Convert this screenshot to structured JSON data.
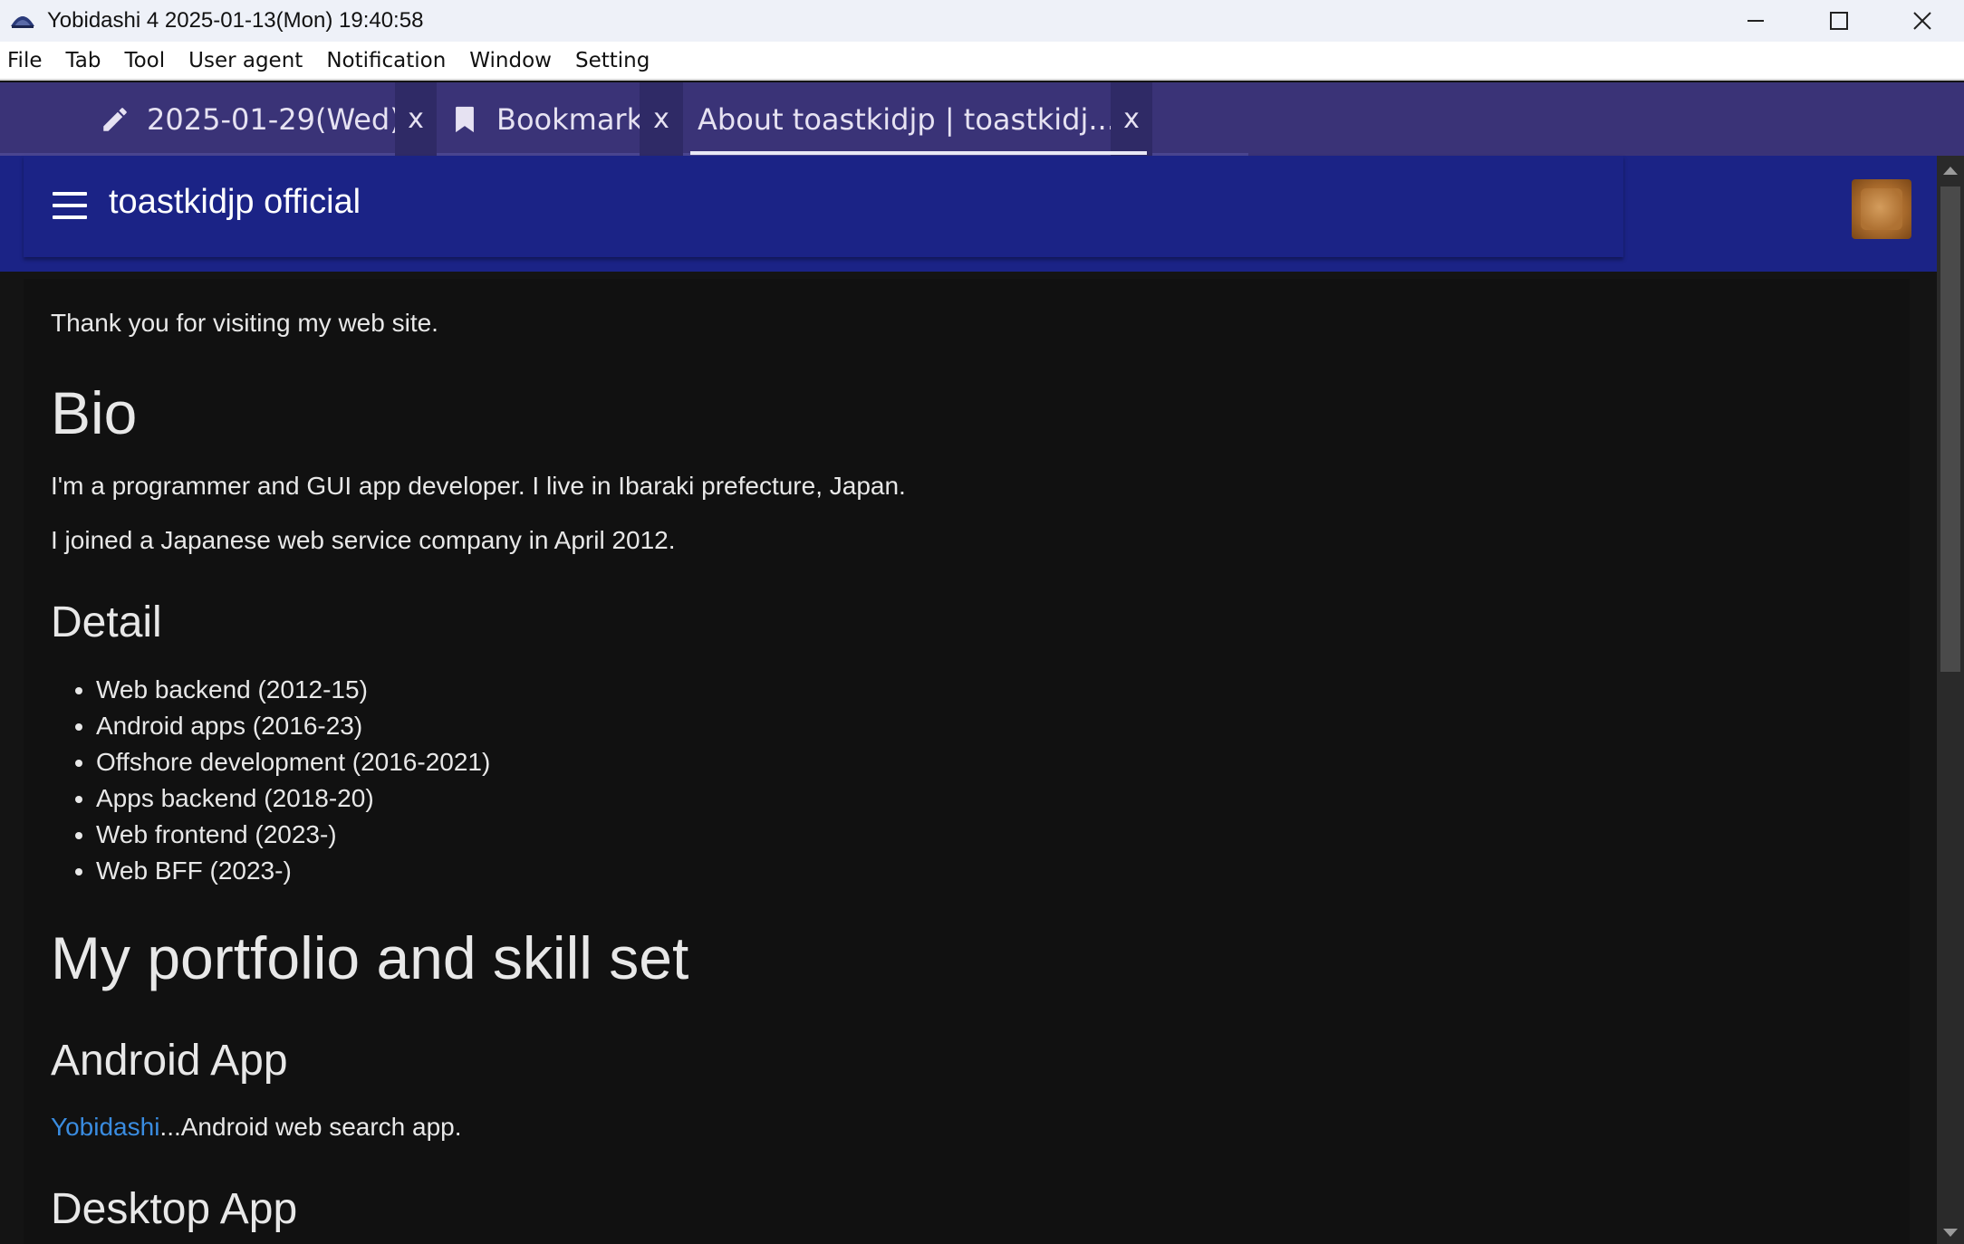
{
  "window": {
    "title": "Yobidashi 4 2025-01-13(Mon) 19:40:58",
    "controls": {
      "minimize": "—",
      "maximize": "☐",
      "close": "✕"
    }
  },
  "menubar": {
    "items": [
      "File",
      "Tab",
      "Tool",
      "User agent",
      "Notification",
      "Window",
      "Setting"
    ]
  },
  "tabs": [
    {
      "label": "2025-01-29(Wed)",
      "icon": "pencil-icon",
      "close": "x"
    },
    {
      "label": "Bookmark",
      "icon": "bookmark-icon",
      "close": "x"
    },
    {
      "label": "About toastkidjp | toastkidj...",
      "icon": "",
      "close": "x",
      "active": true
    }
  ],
  "site": {
    "title": "toastkidjp official",
    "avatar_icon": "avatar"
  },
  "article": {
    "intro": "Thank you for visiting my web site.",
    "bio_heading": "Bio",
    "bio_p1": "I'm a programmer and GUI app developer. I live in Ibaraki prefecture, Japan.",
    "bio_p2": "I joined a Japanese web service company in April 2012.",
    "detail_heading": "Detail",
    "detail_items": [
      "Web backend (2012-15)",
      "Android apps (2016-23)",
      "Offshore development (2016-2021)",
      "Apps backend (2018-20)",
      "Web frontend (2023-)",
      "Web BFF (2023-)"
    ],
    "portfolio_heading": "My portfolio and skill set",
    "android_heading": "Android App",
    "android_link": "Yobidashi",
    "android_desc": "...Android web search app.",
    "desktop_heading": "Desktop App"
  },
  "colors": {
    "titlebar_bg": "#eef1f8",
    "tabbar_bg": "#3a3377",
    "header_bg": "#1b2386",
    "content_bg": "#111111",
    "link": "#3a8ce0"
  }
}
